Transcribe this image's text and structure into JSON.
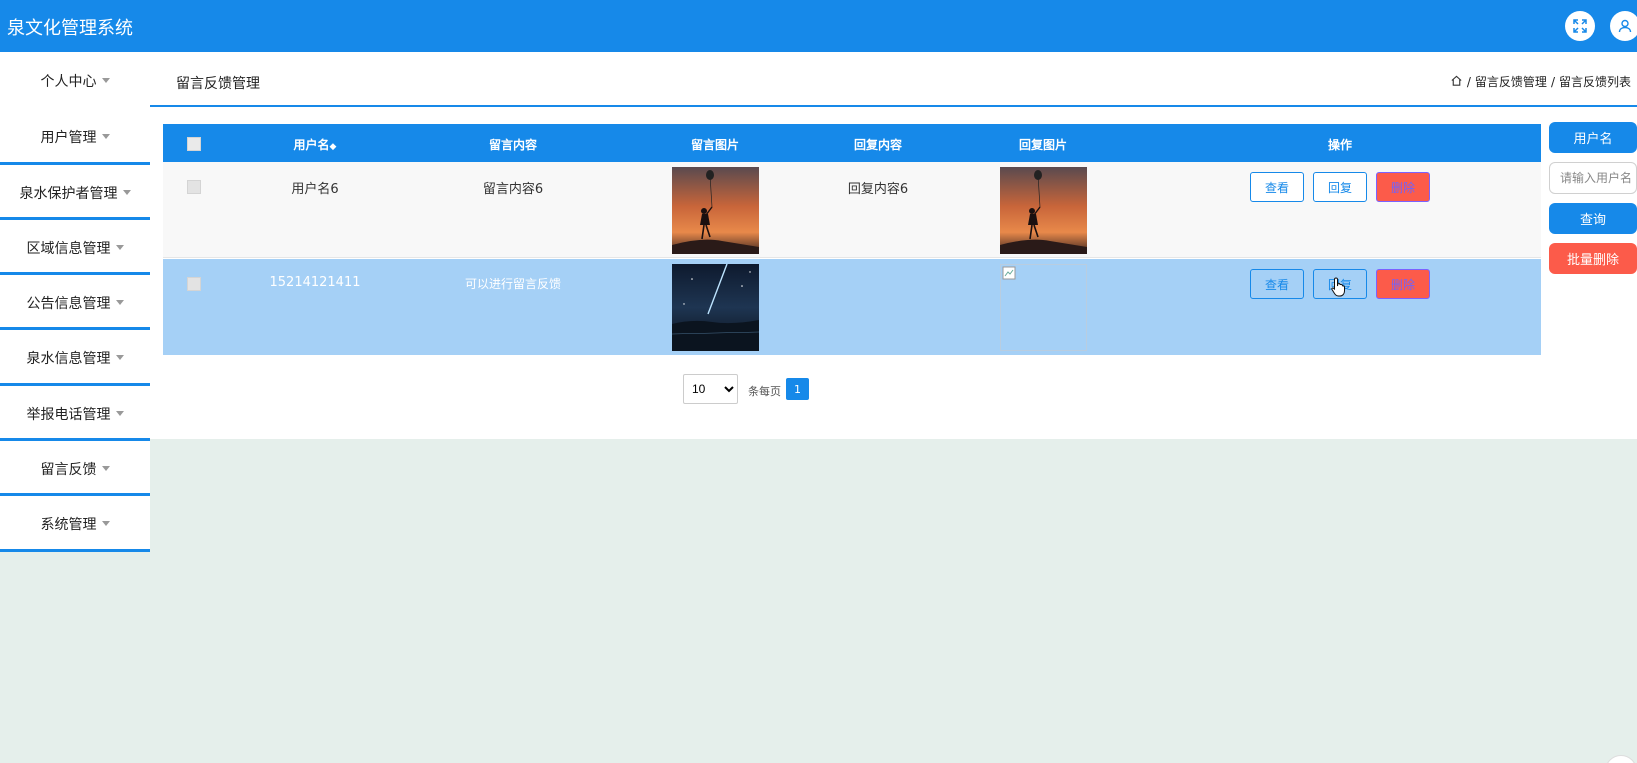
{
  "app": {
    "title": "泉文化管理系统"
  },
  "header": {
    "page_title": "留言反馈管理",
    "breadcrumb": [
      "留言反馈管理",
      "留言反馈列表"
    ],
    "separator": "/"
  },
  "sidebar": {
    "items": [
      {
        "label": "个人中心"
      },
      {
        "label": "用户管理"
      },
      {
        "label": "泉水保护者管理"
      },
      {
        "label": "区域信息管理"
      },
      {
        "label": "公告信息管理"
      },
      {
        "label": "泉水信息管理"
      },
      {
        "label": "举报电话管理"
      },
      {
        "label": "留言反馈"
      },
      {
        "label": "系统管理"
      }
    ]
  },
  "table": {
    "columns": {
      "username": "用户名",
      "message": "留言内容",
      "message_image": "留言图片",
      "reply": "回复内容",
      "reply_image": "回复图片",
      "actions": "操作"
    },
    "rows": [
      {
        "username": "用户名6",
        "message": "留言内容6",
        "reply": "回复内容6"
      },
      {
        "username": "15214121411",
        "message": "可以进行留言反馈",
        "reply": ""
      }
    ],
    "actions": {
      "view": "查看",
      "reply": "回复",
      "delete": "删除"
    }
  },
  "search_panel": {
    "field_label": "用户名",
    "placeholder": "请输入用户名",
    "search_button": "查询",
    "batch_delete_button": "批量删除"
  },
  "pagination": {
    "page_size": "10",
    "page_size_options": [
      "10"
    ],
    "per_page_label": "条每页",
    "current_page": "1"
  },
  "colors": {
    "primary": "#1689e9",
    "danger": "#fc5b4a",
    "selected_row": "#a5d0f6",
    "background": "#e5efeb"
  }
}
